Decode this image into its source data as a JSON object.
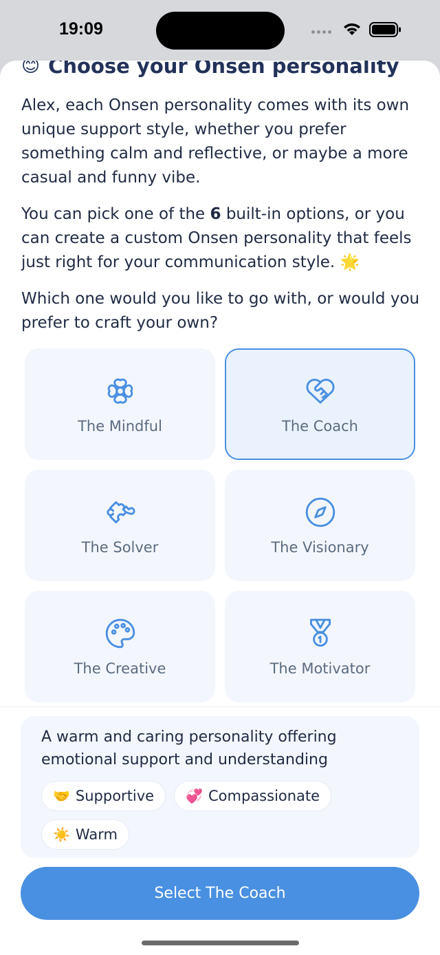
{
  "status_bar": {
    "time": "19:09"
  },
  "header": {
    "emoji": "😊",
    "title": "Choose your Onsen personality"
  },
  "intro": {
    "p1": "Alex, each Onsen personality comes with its own unique support style, whether you prefer something calm and reflective, or maybe a more casual and funny vibe.",
    "p2_before": "You can pick one of the ",
    "p2_count": "6",
    "p2_after": " built-in options, or you can create a custom Onsen personality that feels just right for your communication style. 🌟",
    "p3": "Which one would you like to go with, or would you prefer to craft your own?"
  },
  "personalities": [
    {
      "label": "The Mindful",
      "icon": "flower-icon",
      "selected": false
    },
    {
      "label": "The Coach",
      "icon": "heart-handshake-icon",
      "selected": true
    },
    {
      "label": "The Solver",
      "icon": "puzzle-icon",
      "selected": false
    },
    {
      "label": "The Visionary",
      "icon": "compass-icon",
      "selected": false
    },
    {
      "label": "The Creative",
      "icon": "palette-icon",
      "selected": false
    },
    {
      "label": "The Motivator",
      "icon": "medal-icon",
      "selected": false
    }
  ],
  "description": {
    "text": "A warm and caring personality offering emotional support and understanding",
    "tags": [
      {
        "emoji": "🤝",
        "label": "Supportive"
      },
      {
        "emoji": "💞",
        "label": "Compassionate"
      },
      {
        "emoji": "☀️",
        "label": "Warm"
      }
    ]
  },
  "select_button": {
    "label": "Select The Coach"
  },
  "colors": {
    "accent": "#4a90e2",
    "card_bg": "#f3f7fd",
    "title": "#22325a"
  }
}
